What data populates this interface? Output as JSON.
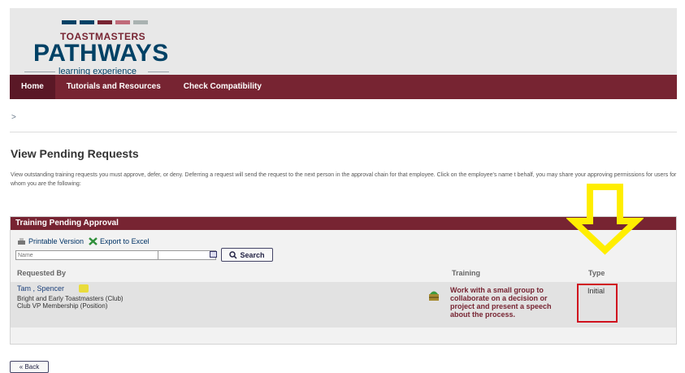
{
  "brand": {
    "top": "TOASTMASTERS",
    "main": "PATHWAYS",
    "sub": "learning experience",
    "stripe_colors": [
      "#004165",
      "#004165",
      "#772432",
      "#c06b7a",
      "#a9b2b1"
    ]
  },
  "nav": {
    "items": [
      "Home",
      "Tutorials and Resources",
      "Check Compatibility"
    ],
    "active": "Home",
    "color": "#772432"
  },
  "breadcrumb": ">",
  "page": {
    "title": "View Pending Requests",
    "description": "View outstanding training requests you must approve, defer, or deny. Deferring a request will send the request to the next person in the approval chain for that employee. Click on the employee's name t behalf, you may share your approving permissions for users for whom you are the following:"
  },
  "panel": {
    "title": "Training Pending Approval",
    "printable_label": "Printable Version",
    "export_label": "Export to Excel",
    "name_placeholder": "Name",
    "search_label": "Search",
    "columns": {
      "requested_by": "Requested By",
      "training": "Training",
      "type": "Type"
    },
    "rows": [
      {
        "name": "Tam , Spencer",
        "club": "Bright and Early Toastmasters (Club)",
        "position": "Club VP Membership (Position)",
        "training": "Work with a small group to collaborate on a decision or project and present a speech about the process.",
        "type": "Initial"
      }
    ]
  },
  "back_label": "« Back",
  "annotation_colors": {
    "arrow": "#ffee00",
    "highlight_box": "#d0121e"
  }
}
